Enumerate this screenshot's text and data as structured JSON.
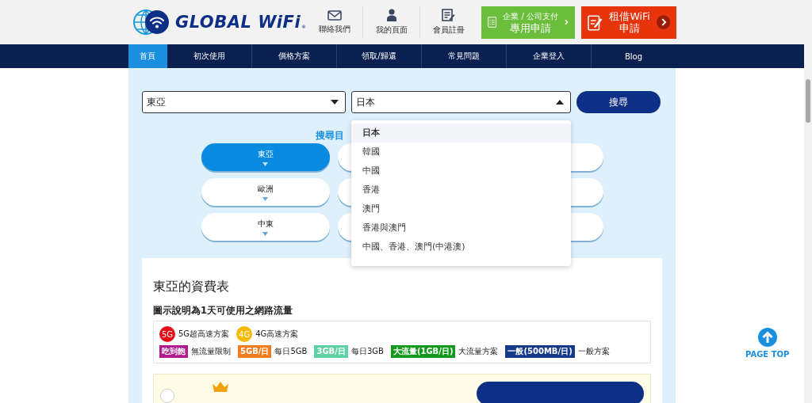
{
  "header": {
    "logo_text": "GLOBAL WiFi",
    "logo_mark": "®",
    "links": [
      {
        "label": "聯絡我們",
        "kind": "mail"
      },
      {
        "label": "我的頁面",
        "kind": "person"
      },
      {
        "label": "會員註冊",
        "kind": "form"
      }
    ],
    "corporate_button": {
      "line1": "企業 / 公司支付",
      "line2": "專用申請"
    },
    "rent_button": {
      "line1": "租借WiFi",
      "line2": "申請"
    }
  },
  "nav": [
    {
      "label": "首頁",
      "selected": true
    },
    {
      "label": "初次使用",
      "selected": false
    },
    {
      "label": "價格方案",
      "selected": false
    },
    {
      "label": "領取/歸還",
      "selected": false
    },
    {
      "label": "常見問題",
      "selected": false
    },
    {
      "label": "企業登入",
      "selected": false
    },
    {
      "label": "Blog",
      "selected": false
    }
  ],
  "search": {
    "region_select": "東亞",
    "country_select": "日本",
    "country_open": true,
    "button": "搜尋",
    "heading": "搜尋目",
    "options": [
      {
        "label": "日本",
        "selected": true
      },
      {
        "label": "韓國",
        "selected": false
      },
      {
        "label": "中國",
        "selected": false
      },
      {
        "label": "香港",
        "selected": false
      },
      {
        "label": "澳門",
        "selected": false
      },
      {
        "label": "香港與澳門",
        "selected": false
      },
      {
        "label": "中國、香港、澳門(中港澳)",
        "selected": false
      }
    ]
  },
  "regions": [
    {
      "label": "東亞",
      "selected": true
    },
    {
      "label": "歐洲",
      "selected": false
    },
    {
      "label": "中東",
      "selected": false
    }
  ],
  "rates": {
    "title": "東亞的資費表",
    "subtitle": "圖示說明為1天可使用之網路流量",
    "legend_speed": [
      {
        "badge": "5G",
        "label": "5G超高速方案",
        "color": "#e60f19"
      },
      {
        "badge": "4G",
        "label": "4G高速方案",
        "color": "#f7b900"
      }
    ],
    "legend_data": [
      {
        "badge": "吃到飽",
        "label": "無流量限制",
        "color": "#b0198f"
      },
      {
        "badge": "5GB/日",
        "label": "每日5GB",
        "color": "#f07c1e"
      },
      {
        "badge": "3GB/日",
        "label": "每日3GB",
        "color": "#5dd0a4"
      },
      {
        "badge": "大流量(1GB/日)",
        "label": "大流量方案",
        "color": "#14991f"
      },
      {
        "badge": "一般(500MB/日)",
        "label": "一般方案",
        "color": "#163b8a"
      }
    ]
  },
  "page_top": "PAGE TOP"
}
